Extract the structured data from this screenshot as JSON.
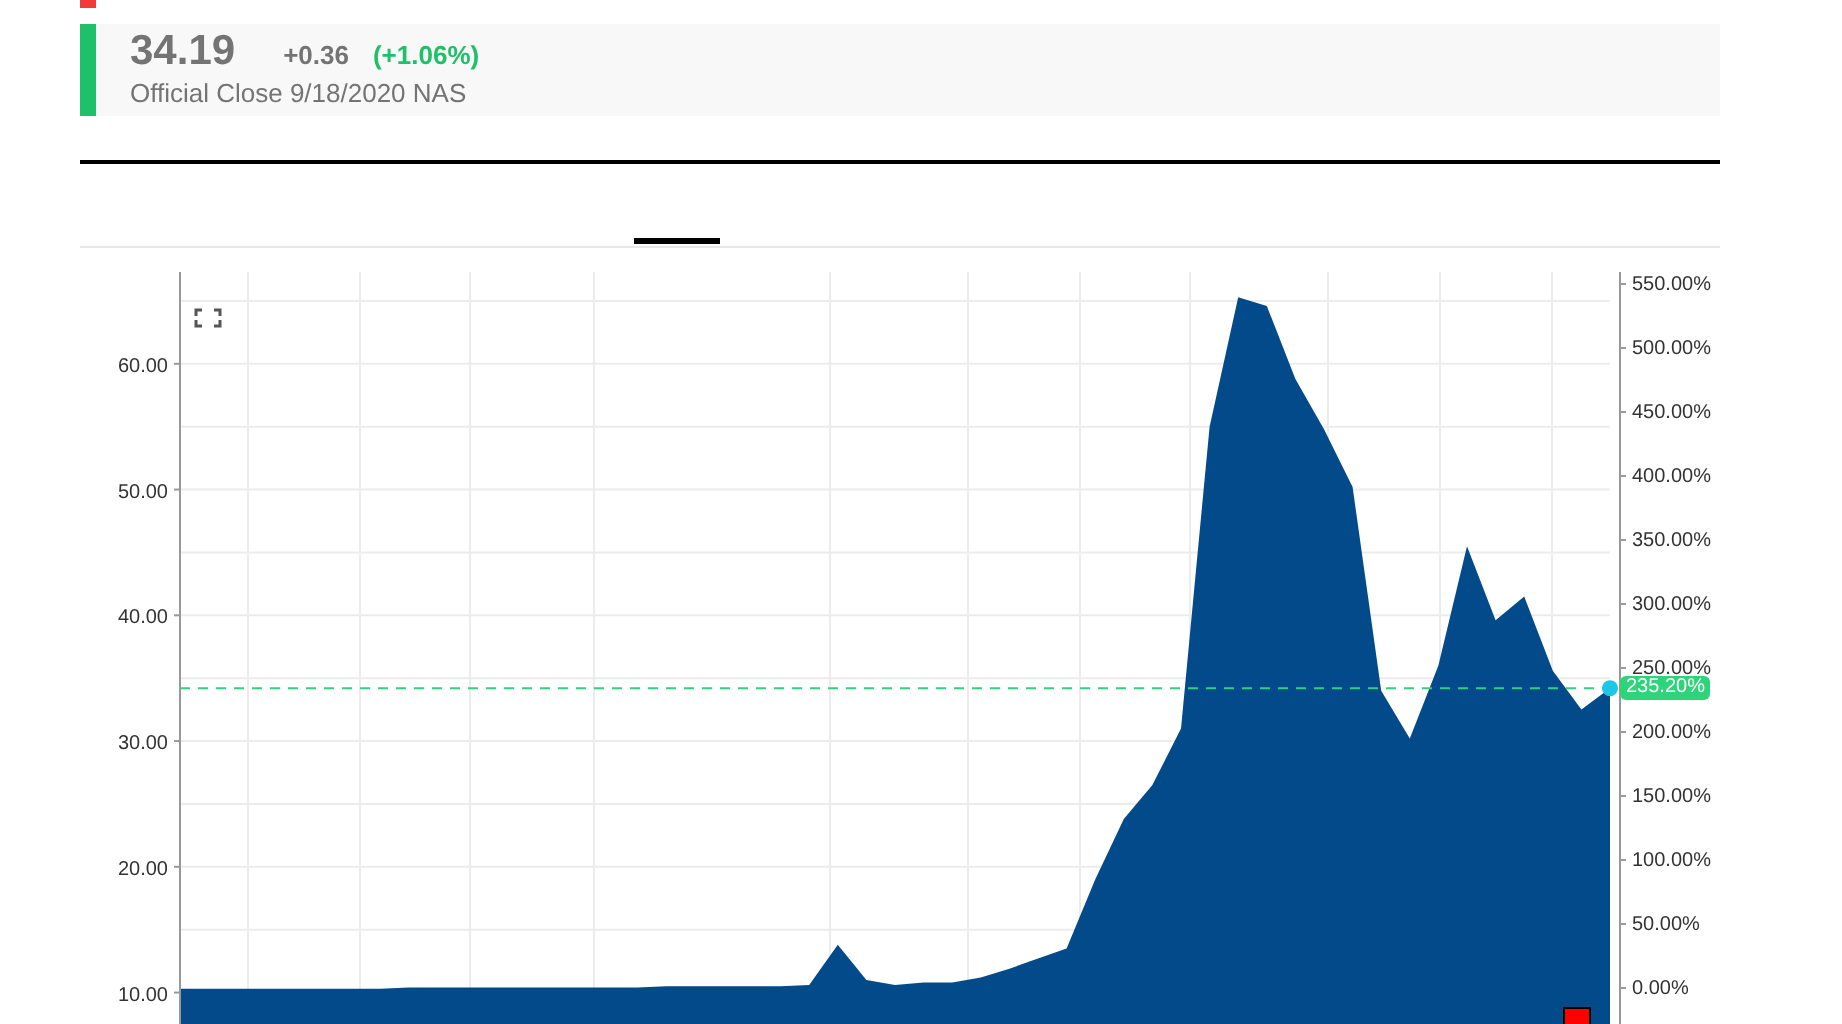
{
  "quote": {
    "price": "34.19",
    "change": "+0.36",
    "change_percent": "(+1.06%)",
    "status": "Official Close 9/18/2020 NAS"
  },
  "chart": {
    "last_value_label": "235.20%",
    "right_axis_labels": [
      "550.00%",
      "500.00%",
      "450.00%",
      "400.00%",
      "350.00%",
      "300.00%",
      "250.00%",
      "200.00%",
      "150.00%",
      "100.00%",
      "50.00%",
      "0.00%"
    ],
    "chart_data": {
      "type": "area",
      "grid": true,
      "series": [
        {
          "color": "#034a8a",
          "values": [
            10.3,
            10.3,
            10.3,
            10.3,
            10.3,
            10.3,
            10.3,
            10.3,
            10.4,
            10.4,
            10.4,
            10.4,
            10.4,
            10.4,
            10.4,
            10.4,
            10.4,
            10.5,
            10.5,
            10.5,
            10.5,
            10.5,
            10.6,
            13.8,
            11.0,
            10.6,
            10.8,
            10.8,
            11.2,
            11.9,
            12.7,
            13.5,
            19.0,
            23.8,
            26.5,
            31.0,
            55.0,
            65.3,
            64.6,
            58.8,
            54.8,
            50.2,
            34.0,
            30.2,
            36.0,
            45.5,
            39.6,
            41.5,
            35.6,
            32.5,
            34.2
          ]
        }
      ],
      "ref_lines": [
        {
          "value": 34.2,
          "axis": "y",
          "color": "#2ed47a"
        }
      ],
      "ylim": [
        7.5,
        67.3
      ],
      "yticks": [
        {
          "value": 10,
          "label": "10.00"
        },
        {
          "value": 20,
          "label": "20.00"
        },
        {
          "value": 30,
          "label": "30.00"
        },
        {
          "value": 40,
          "label": "40.00"
        },
        {
          "value": 50,
          "label": "50.00"
        },
        {
          "value": 60,
          "label": "60.00"
        }
      ]
    }
  }
}
